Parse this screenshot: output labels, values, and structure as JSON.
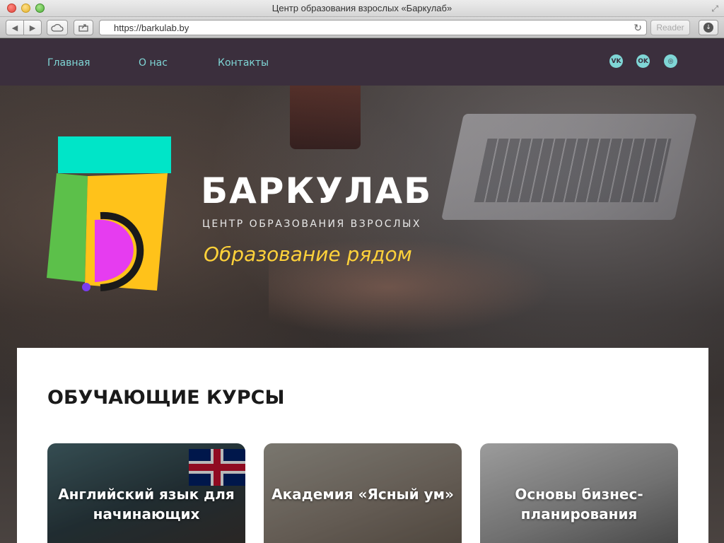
{
  "browser": {
    "window_title": "Центр образования взрослых «Баркулаб»",
    "url": "https://barkulab.by",
    "reader_label": "Reader"
  },
  "nav": {
    "links": [
      {
        "label": "Главная"
      },
      {
        "label": "О нас"
      },
      {
        "label": "Контакты"
      }
    ],
    "social": [
      {
        "icon": "vk-icon",
        "glyph": "VK"
      },
      {
        "icon": "odnoklassniki-icon",
        "glyph": "OK"
      },
      {
        "icon": "instagram-icon",
        "glyph": "◎"
      }
    ]
  },
  "hero": {
    "brand_name": "БАРКУЛАБ",
    "brand_subtitle": "ЦЕНТР ОБРАЗОВАНИЯ ВЗРОСЛЫХ",
    "tagline": "Образование рядом"
  },
  "courses": {
    "section_title": "ОБУЧАЮЩИЕ КУРСЫ",
    "items": [
      {
        "title": "Английский язык для начинающих"
      },
      {
        "title": "Академия «Ясный ум»"
      },
      {
        "title": "Основы бизнес-планирования"
      }
    ]
  },
  "colors": {
    "nav_bg": "#3b2f3d",
    "nav_link": "#7fd6d6",
    "tagline": "#ffd23a",
    "logo_teal": "#00e5c8",
    "logo_green": "#5cc04a",
    "logo_yellow": "#ffc21a",
    "logo_magenta": "#e63cf0",
    "logo_purple": "#7a3cf0"
  }
}
